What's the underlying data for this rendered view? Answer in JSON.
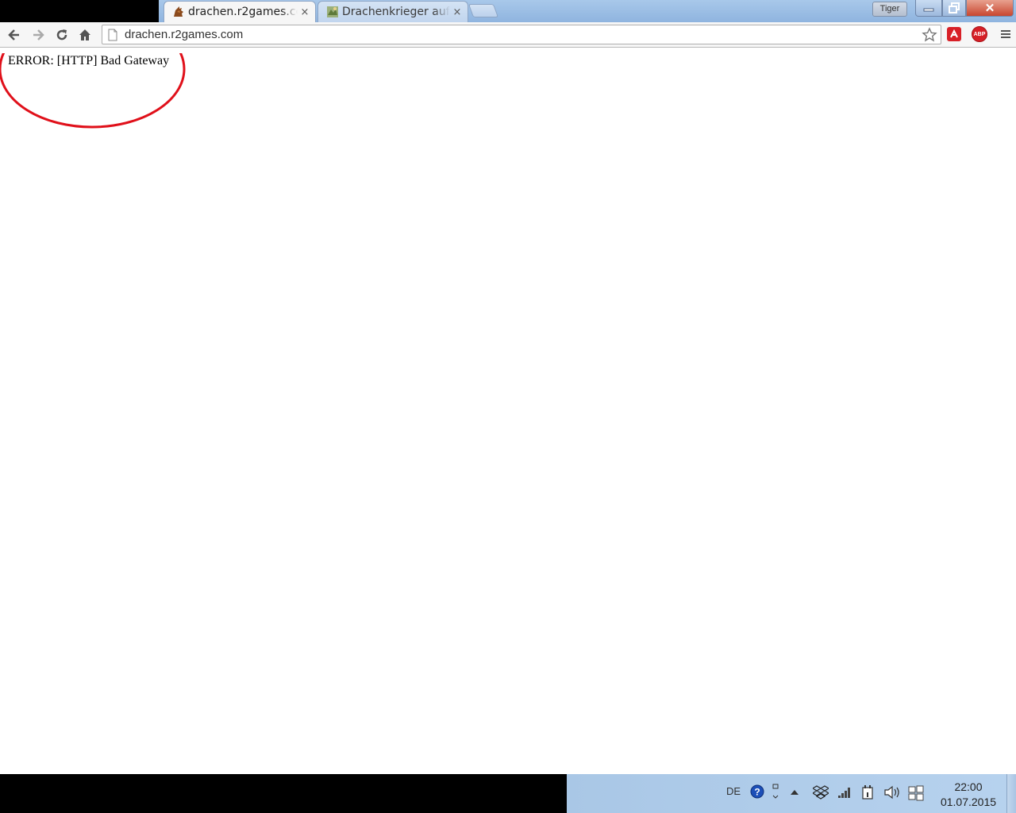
{
  "browser": {
    "tabs": [
      {
        "title": "drachen.r2games.com",
        "active": true,
        "close": "×"
      },
      {
        "title": "Drachenkrieger auf F",
        "active": false,
        "close": "×"
      }
    ],
    "profile_name": "Tiger",
    "window_close": "✕",
    "address_bar": {
      "url": "drachen.r2games.com"
    },
    "extensions": {
      "abp_label": "ABP"
    }
  },
  "page": {
    "error_message": "ERROR: [HTTP] Bad Gateway"
  },
  "taskbar": {
    "language": "DE",
    "time": "22:00",
    "date": "01.07.2015"
  },
  "colors": {
    "annotation": "#e0101a",
    "loading_bar": "#a8d098",
    "titlebar": "#a8c8ea"
  }
}
